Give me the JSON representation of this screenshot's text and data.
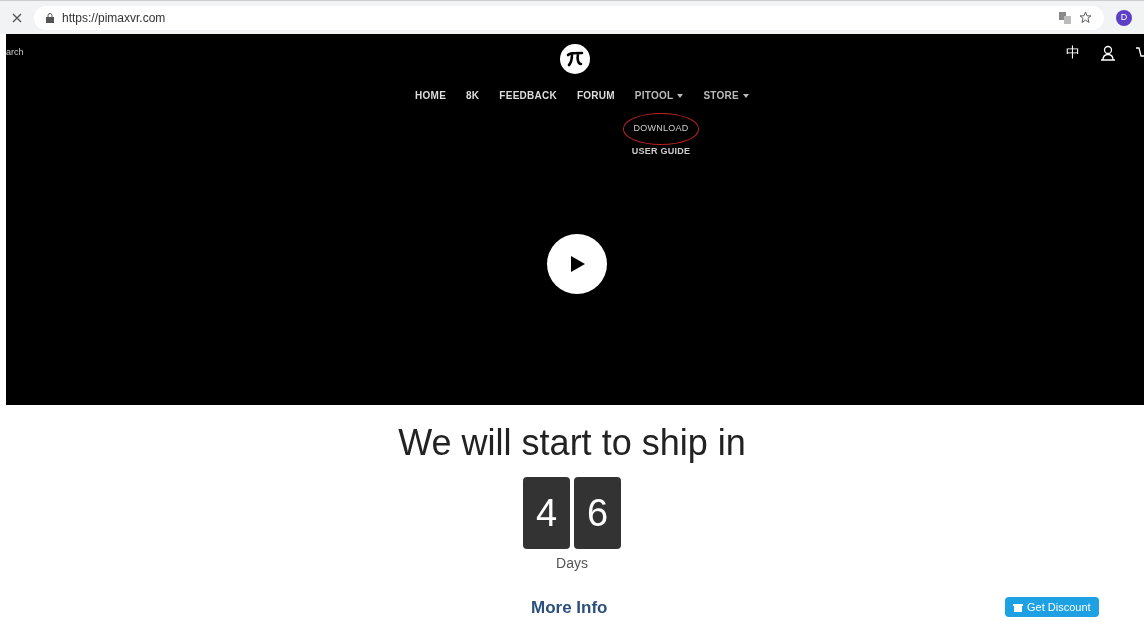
{
  "browser": {
    "url": "https://pimaxvr.com",
    "profile_initial": "D"
  },
  "site": {
    "search_label": "arch",
    "language": "中",
    "nav": [
      {
        "label": "HOME",
        "dropdown": false
      },
      {
        "label": "8K",
        "dropdown": false
      },
      {
        "label": "FEEDBACK",
        "dropdown": false
      },
      {
        "label": "FORUM",
        "dropdown": false
      },
      {
        "label": "PITOOL",
        "dropdown": true
      },
      {
        "label": "STORE",
        "dropdown": true
      }
    ],
    "dropdown_items": [
      {
        "label": "DOWNLOAD",
        "circled": true
      },
      {
        "label": "USER GUIDE",
        "circled": false
      }
    ]
  },
  "countdown": {
    "heading": "We will start to ship in",
    "digits": [
      "4",
      "6"
    ],
    "unit": "Days"
  },
  "more_info": "More Info",
  "discount_button": "Get Discount"
}
